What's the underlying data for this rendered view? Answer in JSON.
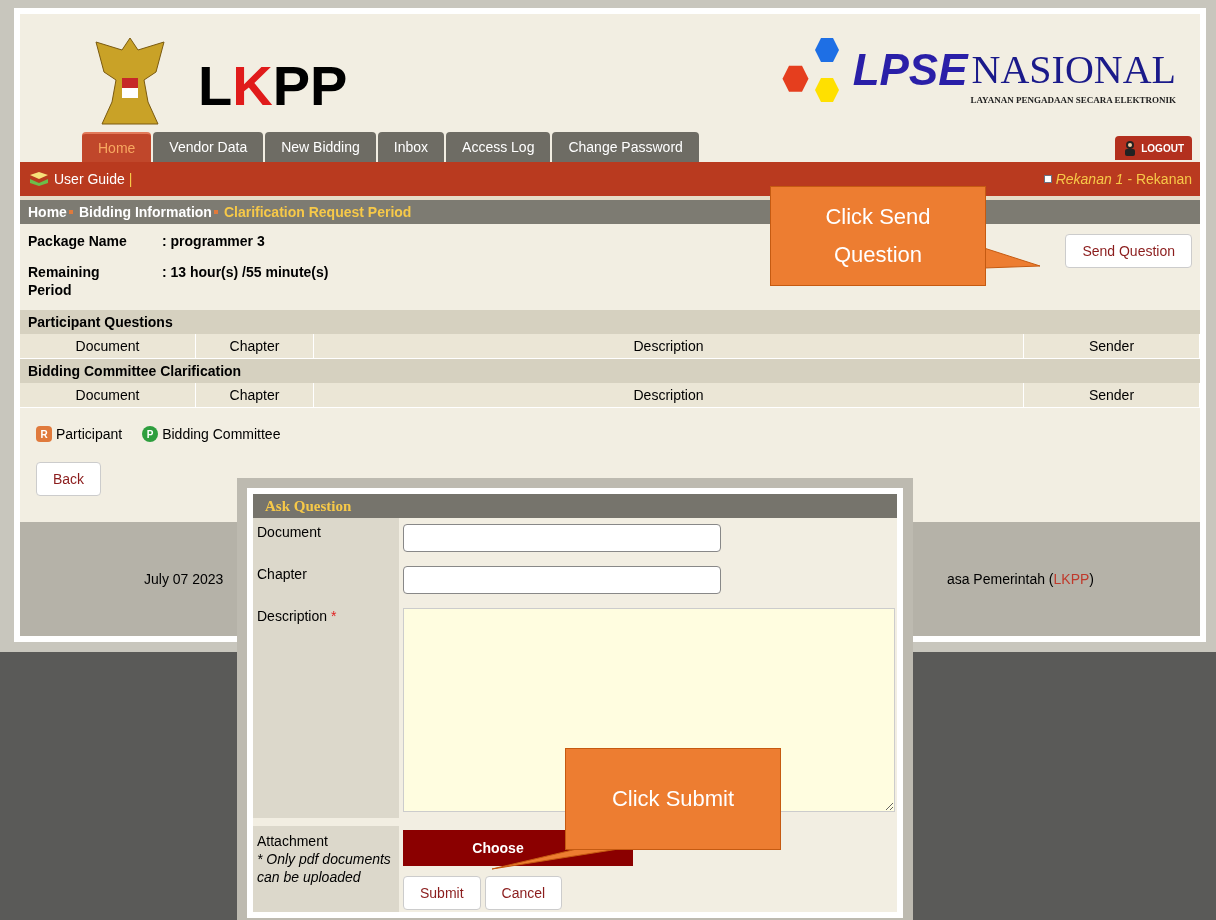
{
  "header": {
    "logo_left": {
      "parts": [
        "L",
        "K",
        "PP"
      ]
    },
    "logo_right": {
      "title_a": "LPSE",
      "title_b": "NASIONAL",
      "subtitle": "LAYANAN PENGADAAN SECARA ELEKTRONIK"
    },
    "logout": "LOGOUT"
  },
  "tabs": [
    {
      "label": "Home",
      "selected": true
    },
    {
      "label": "Vendor Data",
      "selected": false
    },
    {
      "label": "New Bidding",
      "selected": false
    },
    {
      "label": "Inbox",
      "selected": false
    },
    {
      "label": "Access Log",
      "selected": false
    },
    {
      "label": "Change Password",
      "selected": false
    }
  ],
  "toolbar": {
    "user_guide": "User Guide",
    "separator": "|",
    "user_name": "Rekanan 1",
    "user_role": "- Rekanan"
  },
  "breadcrumb": [
    {
      "label": "Home",
      "current": false
    },
    {
      "label": "Bidding Information",
      "current": false
    },
    {
      "label": "Clarification Request Period",
      "current": true
    }
  ],
  "info": [
    {
      "label": "Package Name",
      "value": ": programmer 3"
    },
    {
      "label": "Remaining Period",
      "value": ": 13 hour(s) /55 minute(s)"
    }
  ],
  "send_question_button": "Send Question",
  "sections": [
    {
      "title": "Participant Questions",
      "columns": [
        "Document",
        "Chapter",
        "Description",
        "Sender"
      ]
    },
    {
      "title": "Bidding Committee Clarification",
      "columns": [
        "Document",
        "Chapter",
        "Description",
        "Sender"
      ]
    }
  ],
  "legend": [
    {
      "letter": "R",
      "label": "Participant",
      "color": "#e07a3c"
    },
    {
      "letter": "P",
      "label": "Bidding Committee",
      "color": "#2e9e3e"
    }
  ],
  "back_button": "Back",
  "footer": {
    "left": "July 07 2023",
    "right": "asa Pemerintah (",
    "link": "LKPP",
    "right_end": ")"
  },
  "dialog": {
    "title": "Ask Question",
    "fields": [
      {
        "kind": "text",
        "label": "Document",
        "required": false
      },
      {
        "kind": "text",
        "label": "Chapter",
        "required": false
      },
      {
        "kind": "textarea",
        "label": "Description",
        "required": true
      }
    ],
    "attachment_label": "Attachment",
    "attachment_note": "* Only pdf documents can be uploaded",
    "choose_button": "Choose",
    "required_mark": "*",
    "buttons": [
      "Submit",
      "Cancel"
    ]
  },
  "callouts": [
    {
      "text": "Click Send Question"
    },
    {
      "text": "Click Submit"
    }
  ]
}
